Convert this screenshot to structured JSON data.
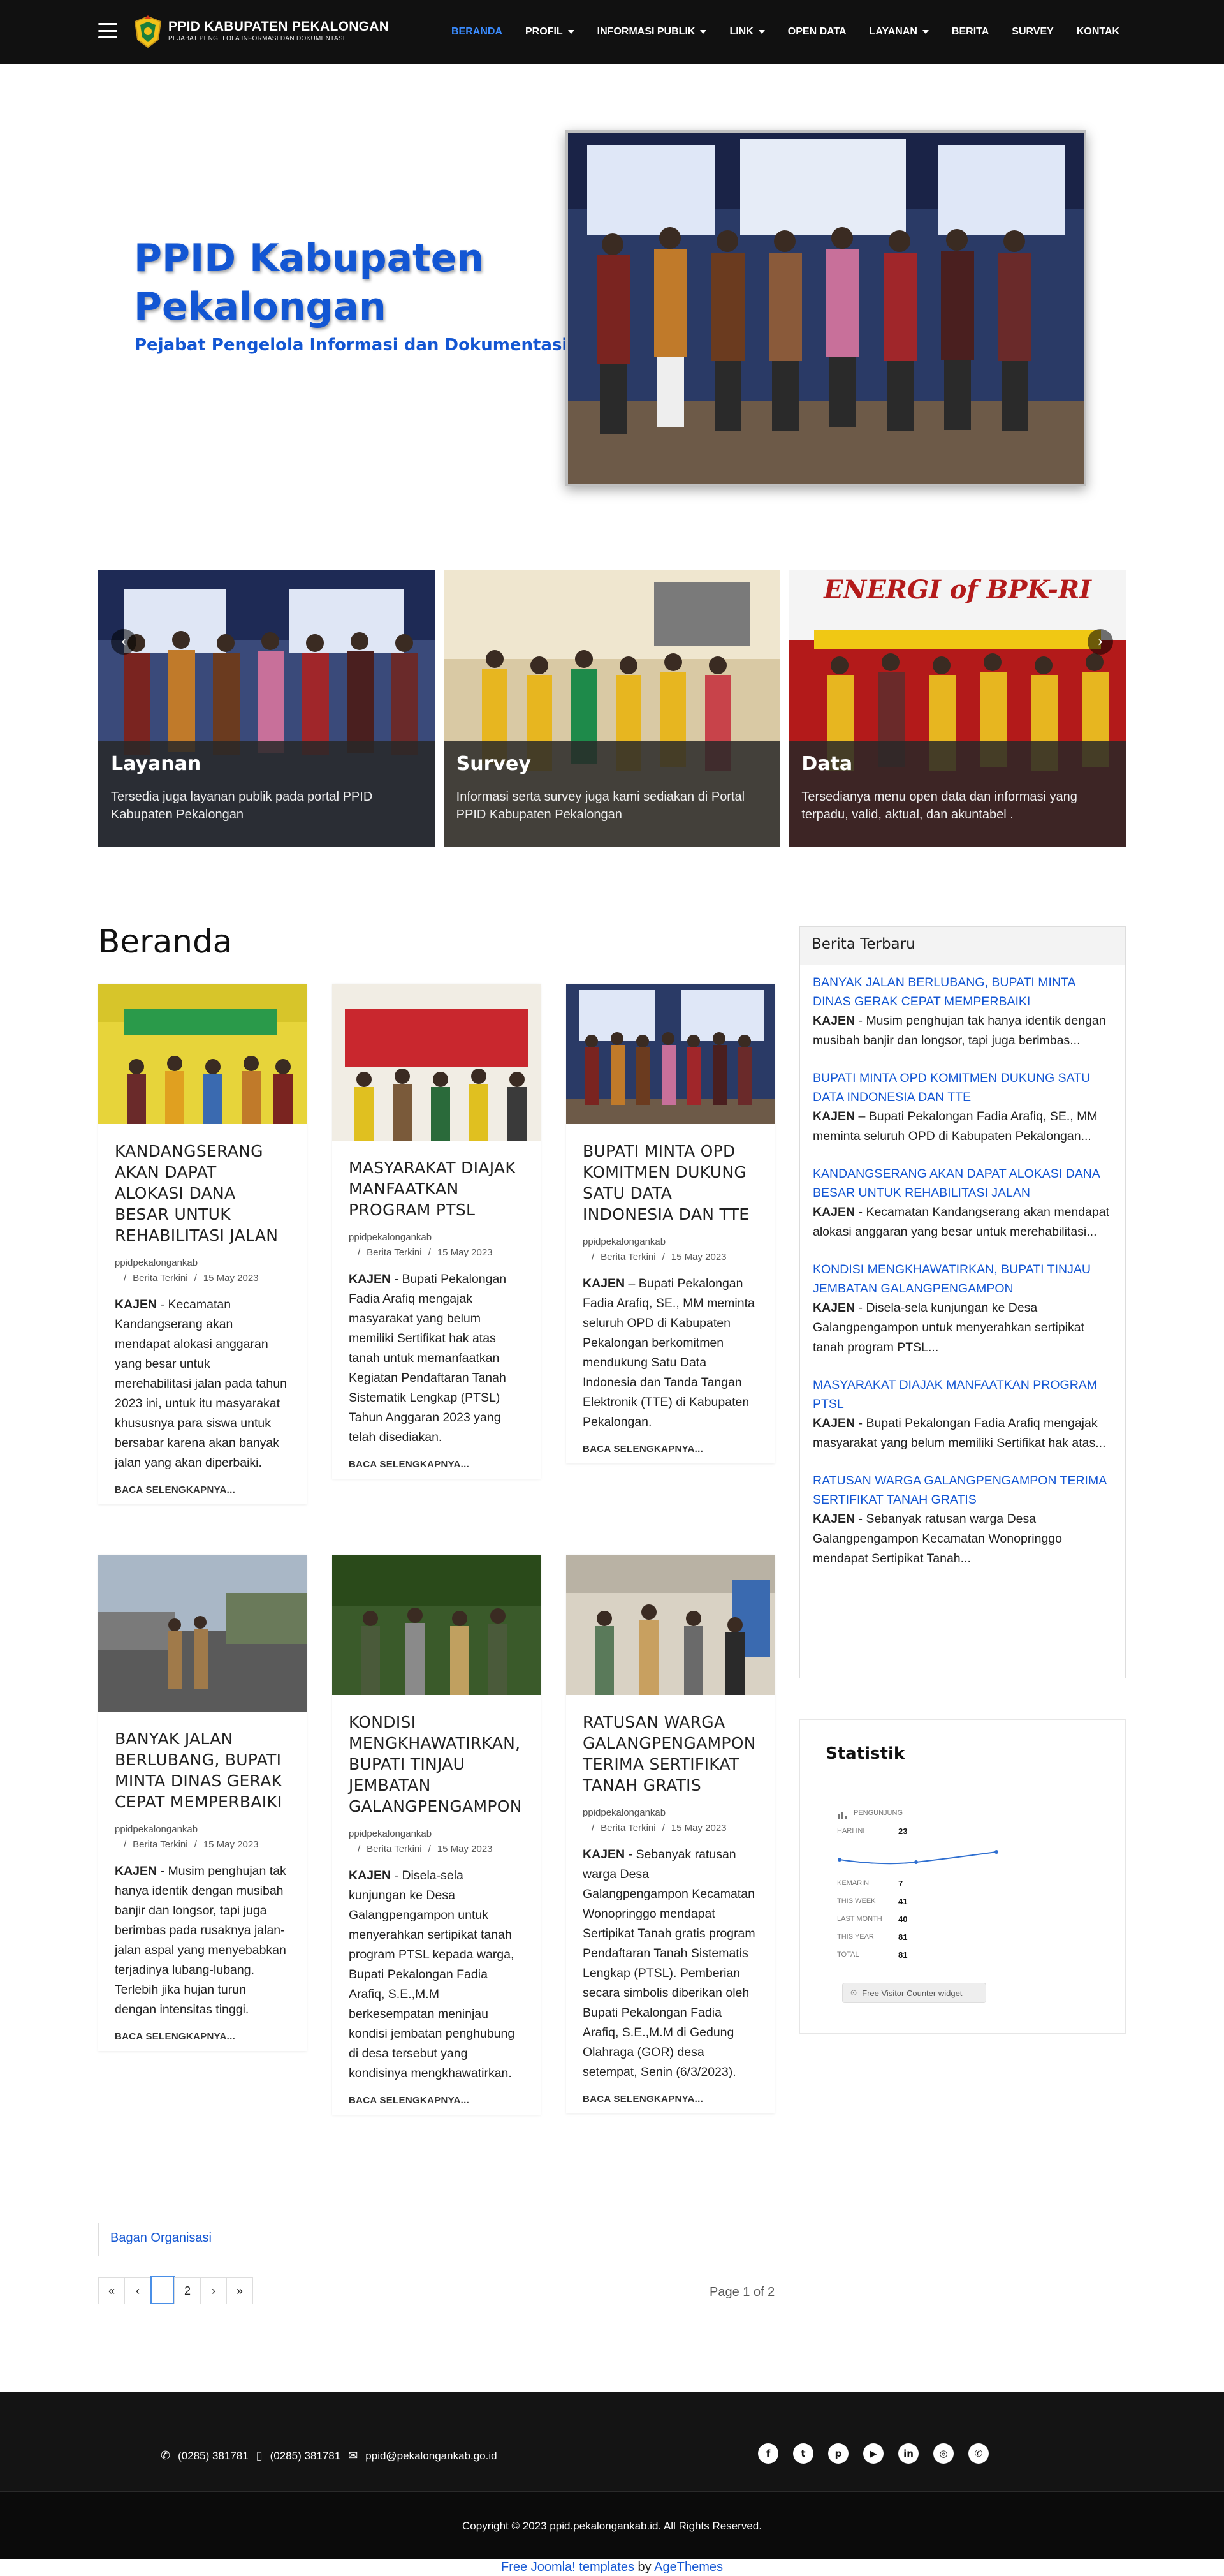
{
  "header": {
    "title": "PPID KABUPATEN PEKALONGAN",
    "subtitle": "PEJABAT PENGELOLA INFORMASI DAN DOKUMENTASI",
    "nav": [
      {
        "label": "BERANDA",
        "active": true,
        "dropdown": false
      },
      {
        "label": "PROFIL",
        "active": false,
        "dropdown": true
      },
      {
        "label": "INFORMASI PUBLIK",
        "active": false,
        "dropdown": true
      },
      {
        "label": "LINK",
        "active": false,
        "dropdown": true
      },
      {
        "label": "OPEN DATA",
        "active": false,
        "dropdown": false
      },
      {
        "label": "LAYANAN",
        "active": false,
        "dropdown": true
      },
      {
        "label": "BERITA",
        "active": false,
        "dropdown": false
      },
      {
        "label": "SURVEY",
        "active": false,
        "dropdown": false
      },
      {
        "label": "KONTAK",
        "active": false,
        "dropdown": false
      }
    ]
  },
  "hero": {
    "title": "PPID Kabupaten Pekalongan",
    "subtitle": "Pejabat Pengelola Informasi dan Dokumentasi"
  },
  "carousel": [
    {
      "title": "Layanan",
      "desc": "Tersedia juga layanan publik pada portal PPID Kabupaten Pekalongan"
    },
    {
      "title": "Survey",
      "desc": "Informasi serta survey juga kami sediakan di Portal PPID Kabupaten Pekalongan"
    },
    {
      "title": "Data",
      "desc": "Tersedianya menu open data dan informasi yang terpadu, valid, aktual, dan akuntabel ."
    }
  ],
  "main": {
    "heading": "Beranda",
    "read_more": "BACA SELENGKAPNYA...",
    "articles": [
      {
        "title": "KANDANGSERANG AKAN DAPAT ALOKASI DANA BESAR UNTUK REHABILITASI JALAN",
        "author": "ppidpekalongankab",
        "category": "Berita Terkini",
        "date": "15 May 2023",
        "lead": "KAJEN",
        "text": " - Kecamatan Kandangserang akan mendapat alokasi anggaran yang besar untuk merehabilitasi jalan pada tahun 2023 ini, untuk itu masyarakat khususnya para siswa untuk bersabar karena akan banyak jalan yang akan diperbaiki."
      },
      {
        "title": "MASYARAKAT DIAJAK MANFAATKAN PROGRAM PTSL",
        "author": "ppidpekalongankab",
        "category": "Berita Terkini",
        "date": "15 May 2023",
        "lead": "KAJEN",
        "text": " - Bupati Pekalongan Fadia Arafiq mengajak masyarakat yang belum memiliki Sertifikat hak atas tanah untuk memanfaatkan Kegiatan Pendaftaran Tanah Sistematik Lengkap (PTSL) Tahun Anggaran 2023 yang telah disediakan."
      },
      {
        "title": "BUPATI MINTA OPD KOMITMEN DUKUNG SATU DATA INDONESIA DAN TTE",
        "author": "ppidpekalongankab",
        "category": "Berita Terkini",
        "date": "15 May 2023",
        "lead": "KAJEN",
        "text": " – Bupati Pekalongan Fadia Arafiq, SE., MM meminta seluruh OPD di Kabupaten Pekalongan berkomitmen mendukung Satu Data Indonesia dan Tanda Tangan Elektronik (TTE) di Kabupaten Pekalongan."
      },
      {
        "title": "BANYAK JALAN BERLUBANG, BUPATI MINTA DINAS GERAK CEPAT MEMPERBAIKI",
        "author": "ppidpekalongankab",
        "category": "Berita Terkini",
        "date": "15 May 2023",
        "lead": "KAJEN",
        "text": " - Musim penghujan tak hanya identik dengan musibah banjir dan longsor, tapi juga berimbas pada rusaknya jalan-jalan aspal yang menyebabkan terjadinya lubang-lubang. Terlebih jika hujan turun dengan intensitas tinggi."
      },
      {
        "title": "KONDISI MENGKHAWATIRKAN, BUPATI TINJAU JEMBATAN GALANGPENGAMPON",
        "author": "ppidpekalongankab",
        "category": "Berita Terkini",
        "date": "15 May 2023",
        "lead": "KAJEN",
        "text": " - Disela-sela kunjungan ke Desa Galangpengampon untuk menyerahkan sertipikat tanah program PTSL kepada warga, Bupati Pekalongan Fadia Arafiq, S.E.,M.M berkesempatan meninjau kondisi jembatan penghubung di desa tersebut yang kondisinya mengkhawatirkan."
      },
      {
        "title": "RATUSAN WARGA GALANGPENGAMPON TERIMA SERTIFIKAT TANAH GRATIS",
        "author": "ppidpekalongankab",
        "category": "Berita Terkini",
        "date": "15 May 2023",
        "lead": "KAJEN",
        "text": " - Sebanyak ratusan warga Desa Galangpengampon Kecamatan Wonopringgo mendapat Sertipikat Tanah gratis program Pendaftaran Tanah Sistematis Lengkap (PTSL). Pemberian secara simbolis diberikan oleh Bupati Pekalongan Fadia Arafiq, S.E.,M.M di Gedung Olahraga (GOR) desa setempat, Senin (6/3/2023)."
      }
    ],
    "bagan": "Bagan Organisasi",
    "pagination": {
      "pages": [
        "«",
        "‹",
        "",
        "2",
        "›",
        "»"
      ],
      "info": "Page 1 of 2"
    }
  },
  "sidebar": {
    "news_title": "Berita Terbaru",
    "news": [
      {
        "title": "BANYAK JALAN BERLUBANG, BUPATI MINTA DINAS GERAK CEPAT MEMPERBAIKI",
        "lead": "KAJEN",
        "text": " - Musim penghujan tak hanya identik dengan musibah banjir dan longsor, tapi juga berimbas..."
      },
      {
        "title": "BUPATI MINTA OPD KOMITMEN DUKUNG SATU DATA INDONESIA DAN TTE",
        "lead": "KAJEN",
        "text": " – Bupati Pekalongan Fadia Arafiq, SE., MM meminta seluruh OPD di Kabupaten Pekalongan..."
      },
      {
        "title": "KANDANGSERANG AKAN DAPAT ALOKASI DANA BESAR UNTUK REHABILITASI JALAN",
        "lead": "KAJEN",
        "text": " - Kecamatan Kandangserang akan mendapat alokasi anggaran yang besar untuk merehabilitasi..."
      },
      {
        "title": "KONDISI MENGKHAWATIRKAN, BUPATI TINJAU JEMBATAN GALANGPENGAMPON",
        "lead": "KAJEN",
        "text": " - Disela-sela kunjungan ke Desa Galangpengampon untuk menyerahkan sertipikat tanah program PTSL..."
      },
      {
        "title": "MASYARAKAT DIAJAK MANFAATKAN PROGRAM PTSL",
        "lead": "KAJEN",
        "text": " - Bupati Pekalongan Fadia Arafiq mengajak masyarakat yang belum memiliki Sertifikat hak atas..."
      },
      {
        "title": "RATUSAN WARGA GALANGPENGAMPON TERIMA SERTIFIKAT TANAH GRATIS",
        "lead": "KAJEN",
        "text": " - Sebanyak ratusan warga Desa Galangpengampon Kecamatan Wonopringgo mendapat Sertipikat Tanah..."
      }
    ],
    "stats_title": "Statistik",
    "stats": {
      "header": "PENGUNJUNG",
      "rows": [
        {
          "label": "HARI INI",
          "value": "23"
        },
        {
          "label": "KEMARIN",
          "value": "7"
        },
        {
          "label": "THIS WEEK",
          "value": "41"
        },
        {
          "label": "LAST MONTH",
          "value": "40"
        },
        {
          "label": "THIS YEAR",
          "value": "81"
        },
        {
          "label": "TOTAL",
          "value": "81"
        }
      ],
      "widget": "Free Visitor Counter widget"
    }
  },
  "footer": {
    "phone1": "(0285) 381781",
    "phone2": "(0285) 381781",
    "email": "ppid@pekalongankab.go.id",
    "social": [
      "facebook-icon",
      "twitter-icon",
      "pinterest-icon",
      "youtube-icon",
      "linkedin-icon",
      "instagram-icon",
      "whatsapp-icon"
    ],
    "copyright": "Copyright © 2023 ppid.pekalongankab.id. All Rights Reserved.",
    "credit_link": "Free Joomla! templates",
    "credit_by": " by ",
    "credit_author": "AgeThemes"
  }
}
